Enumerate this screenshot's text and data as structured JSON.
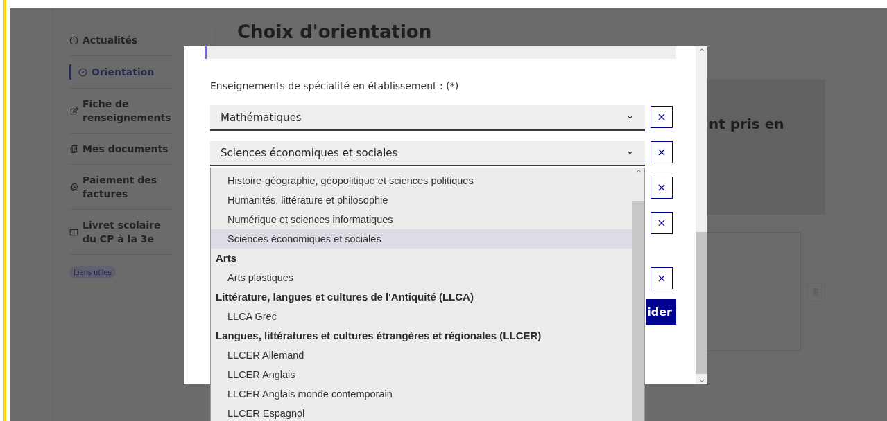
{
  "sidebar": {
    "items": [
      {
        "label": "Actualités",
        "selected": false
      },
      {
        "label": "Orientation",
        "selected": true
      },
      {
        "label": "Fiche de renseignements",
        "selected": false
      },
      {
        "label": "Mes documents",
        "selected": false
      },
      {
        "label": "Paiement des factures",
        "selected": false
      },
      {
        "label": "Livret scolaire du CP à la 3e",
        "selected": false
      }
    ],
    "tag": "Liens utiles"
  },
  "page": {
    "title": "Choix d'orientation",
    "card_text": "nt pris en"
  },
  "modal": {
    "field_label": "Enseignements de spécialité en établissement : (*)",
    "selects": [
      {
        "value": "Mathématiques"
      },
      {
        "value": "Sciences économiques et sociales"
      }
    ],
    "remove_buttons": [
      "×",
      "×",
      "×",
      "×",
      "×"
    ],
    "submit_button": "ider"
  },
  "dropdown": {
    "options": [
      {
        "kind": "option",
        "label": "Histoire-géographie, géopolitique et sciences politiques",
        "selected": false
      },
      {
        "kind": "option",
        "label": "Humanités, littérature et philosophie",
        "selected": false
      },
      {
        "kind": "option",
        "label": "Numérique et sciences informatiques",
        "selected": false
      },
      {
        "kind": "option",
        "label": "Sciences économiques et sociales",
        "selected": true
      },
      {
        "kind": "group",
        "label": "Arts"
      },
      {
        "kind": "option",
        "label": "Arts plastiques",
        "selected": false
      },
      {
        "kind": "group",
        "label": "Littérature, langues et cultures de l'Antiquité (LLCA)"
      },
      {
        "kind": "option",
        "label": "LLCA Grec",
        "selected": false
      },
      {
        "kind": "group",
        "label": "Langues, littératures et cultures étrangères et régionales (LLCER)"
      },
      {
        "kind": "option",
        "label": "LLCER Allemand",
        "selected": false
      },
      {
        "kind": "option",
        "label": "LLCER Anglais",
        "selected": false
      },
      {
        "kind": "option",
        "label": "LLCER Anglais monde contemporain",
        "selected": false
      },
      {
        "kind": "option",
        "label": "LLCER Espagnol",
        "selected": false
      }
    ]
  }
}
